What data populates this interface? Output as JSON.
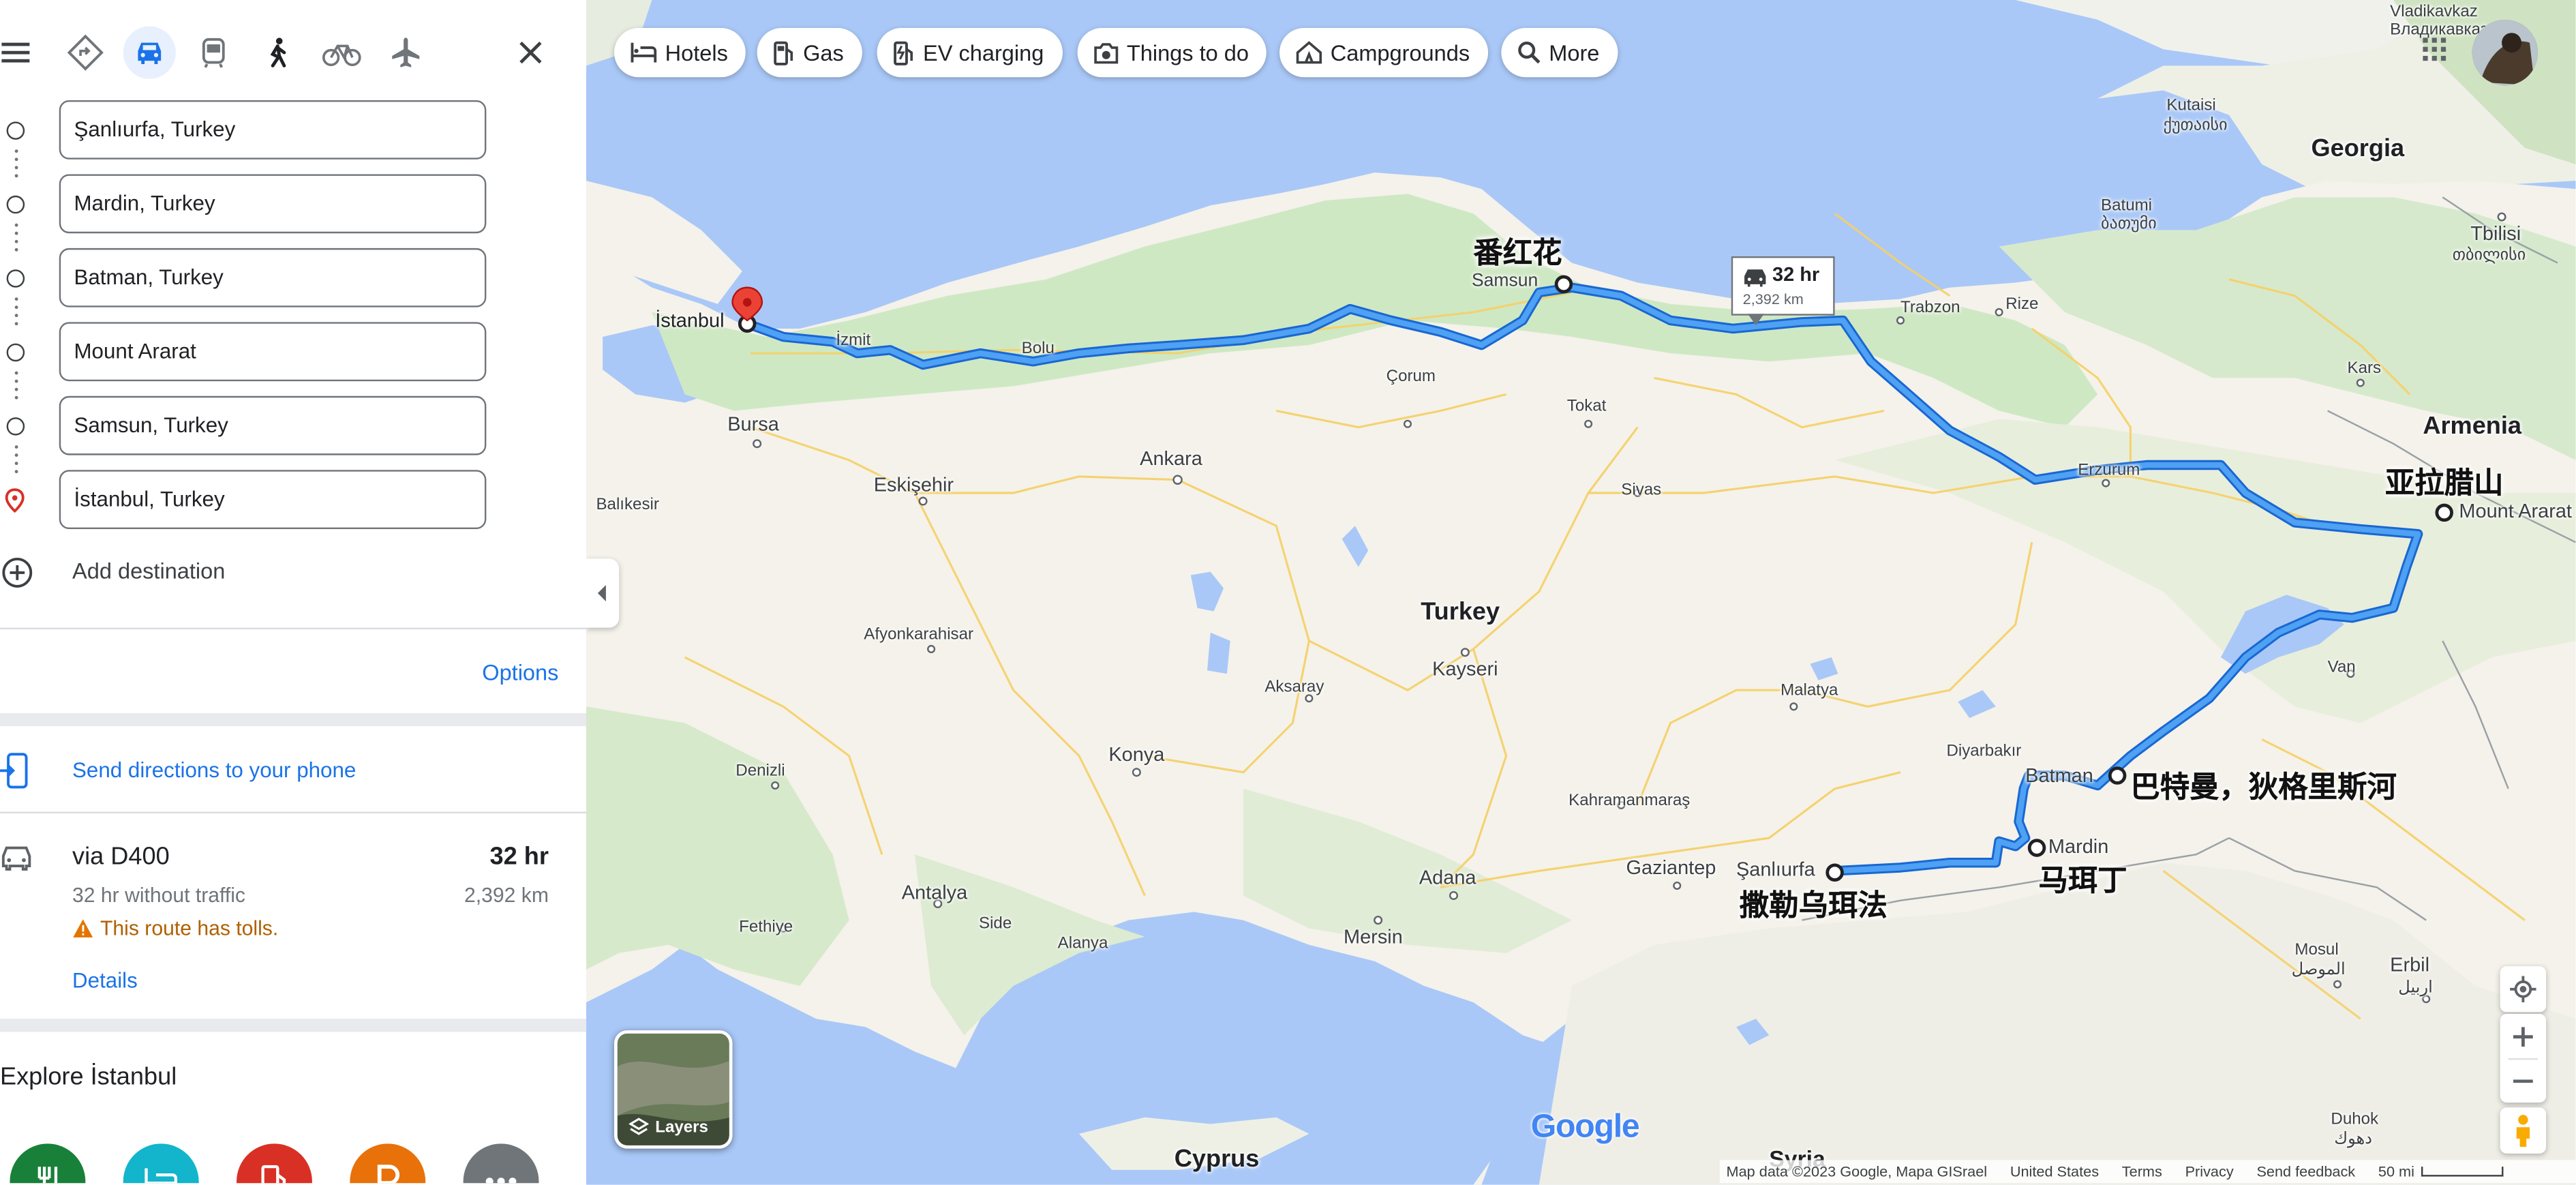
{
  "travel_modes": [
    {
      "name": "best-route",
      "active": false
    },
    {
      "name": "driving",
      "active": true
    },
    {
      "name": "transit",
      "active": false
    },
    {
      "name": "walking",
      "active": false
    },
    {
      "name": "cycling",
      "active": false
    },
    {
      "name": "flights",
      "active": false
    }
  ],
  "waypoints": [
    {
      "value": "Şanlıurfa, Turkey"
    },
    {
      "value": "Mardin, Turkey"
    },
    {
      "value": "Batman, Turkey"
    },
    {
      "value": "Mount Ararat"
    },
    {
      "value": "Samsun, Turkey"
    },
    {
      "value": "İstanbul, Turkey"
    }
  ],
  "add_destination": "Add destination",
  "options_label": "Options",
  "send_directions": "Send directions to your phone",
  "route": {
    "name": "via D400",
    "time": "32 hr",
    "traffic_note": "32 hr without traffic",
    "distance": "2,392 km",
    "warning": "This route has tolls.",
    "details_label": "Details"
  },
  "explore_title": "Explore İstanbul",
  "explore_categories": [
    {
      "icon": "restaurant-icon",
      "color": "#188038"
    },
    {
      "icon": "hotel-icon",
      "color": "#12b5cb"
    },
    {
      "icon": "gas-station-icon",
      "color": "#d93025"
    },
    {
      "icon": "parking-icon",
      "color": "#e8710a"
    },
    {
      "icon": "more-icon",
      "color": "#70757a"
    }
  ],
  "chips": [
    {
      "label": "Hotels",
      "icon": "hotel-icon"
    },
    {
      "label": "Gas",
      "icon": "gas-icon"
    },
    {
      "label": "EV charging",
      "icon": "ev-charging-icon"
    },
    {
      "label": "Things to do",
      "icon": "camera-icon"
    },
    {
      "label": "Campgrounds",
      "icon": "campground-icon"
    },
    {
      "label": "More",
      "icon": "search-icon"
    }
  ],
  "route_bubble": {
    "time": "32 hr",
    "distance": "2,392 km"
  },
  "map_labels": {
    "istanbul": "İstanbul",
    "izmit": "İzmit",
    "bolu": "Bolu",
    "bursa": "Bursa",
    "balikesir": "Balıkesir",
    "eskisehir": "Eskişehir",
    "ankara": "Ankara",
    "corum": "Çorum",
    "samsun": "Samsun",
    "tokat": "Tokat",
    "sivas": "Sivas",
    "trabzon": "Trabzon",
    "rize": "Rize",
    "erzurum": "Erzurum",
    "kars": "Kars",
    "turkey": "Turkey",
    "kayseri": "Kayseri",
    "aksaray": "Aksaray",
    "konya": "Konya",
    "afyon": "Afyonkarahisar",
    "denizli": "Denizli",
    "antalya": "Antalya",
    "fethiye": "Fethiye",
    "side": "Side",
    "alanya": "Alanya",
    "mersin": "Mersin",
    "adana": "Adana",
    "kahramanmaras": "Kahramanmaraş",
    "gaziantep": "Gaziantep",
    "sanliurfa": "Şanlıurfa",
    "mardin": "Mardin",
    "batman": "Batman",
    "diyarbakir": "Diyarbakır",
    "malatya": "Malatya",
    "van": "Van",
    "mount_ararat": "Mount Ararat",
    "armenia": "Armenia",
    "georgia": "Georgia",
    "tbilisi": "Tbilisi",
    "tbilisi_geo": "თბილისი",
    "kutaisi": "Kutaisi",
    "kutaisi_geo": "ქუთაისი",
    "batumi": "Batumi",
    "batumi_geo": "ბათუმი",
    "vladikavkaz": "Vladikavkaz",
    "vladikavkaz_ru": "Владикавказ",
    "mosul": "Mosul",
    "mosul_ar": "الموصل",
    "erbil": "Erbil",
    "erbil_ar": "اربيل",
    "duhok": "Duhok",
    "duhok_ar": "دهوك",
    "cyprus": "Cyprus",
    "syria": "Syria"
  },
  "chinese_labels": {
    "samsun": "番红花",
    "ararat": "亚拉腊山",
    "batman": "巴特曼，狄格里斯河",
    "mardin": "马珥丁",
    "sanliurfa": "撒勒乌珥法"
  },
  "layers_label": "Layers",
  "google_logo": "Google",
  "attribution": [
    "Map data ©2023 Google, Mapa GISrael",
    "United States",
    "Terms",
    "Privacy",
    "Send feedback",
    "50 mi"
  ]
}
